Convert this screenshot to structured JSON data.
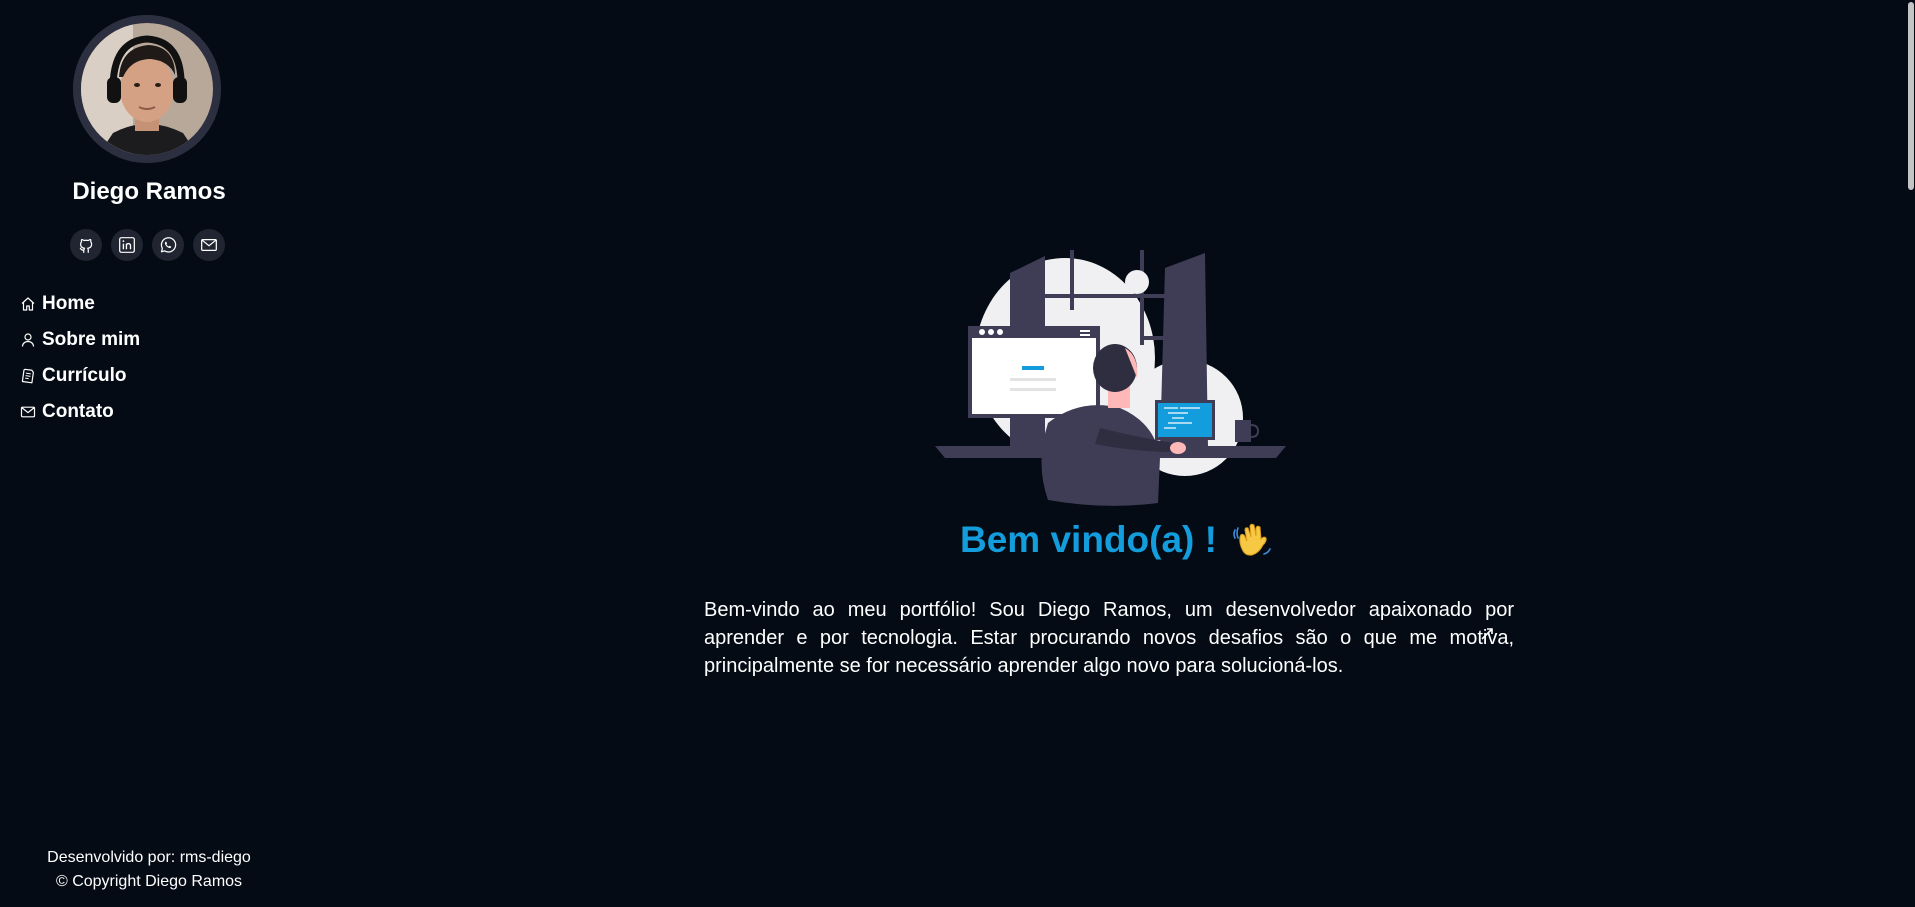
{
  "profile": {
    "name": "Diego Ramos"
  },
  "social": [
    {
      "name": "github-icon"
    },
    {
      "name": "linkedin-icon"
    },
    {
      "name": "whatsapp-icon"
    },
    {
      "name": "envelope-icon"
    }
  ],
  "nav": {
    "items": [
      {
        "icon": "house-icon",
        "label": "Home"
      },
      {
        "icon": "person-icon",
        "label": "Sobre mim"
      },
      {
        "icon": "document-icon",
        "label": "Currículo"
      },
      {
        "icon": "envelope-icon",
        "label": "Contato"
      }
    ]
  },
  "main": {
    "title": "Bem vindo(a) !",
    "wave_icon": "waving-hand-icon",
    "intro": "Bem-vindo ao meu portfólio! Sou Diego Ramos, um desenvolvedor apaixonado por aprender e por tecnologia. Estar procurando novos desafios são o que me motiva, principalmente se for necessário aprender algo novo para solucioná-los."
  },
  "footer": {
    "developed_by": "Desenvolvido por: rms-diego",
    "copyright": "© Copyright Diego Ramos"
  },
  "colors": {
    "background": "#040b14",
    "accent": "#149ddd",
    "sidebar_button": "#212431"
  }
}
